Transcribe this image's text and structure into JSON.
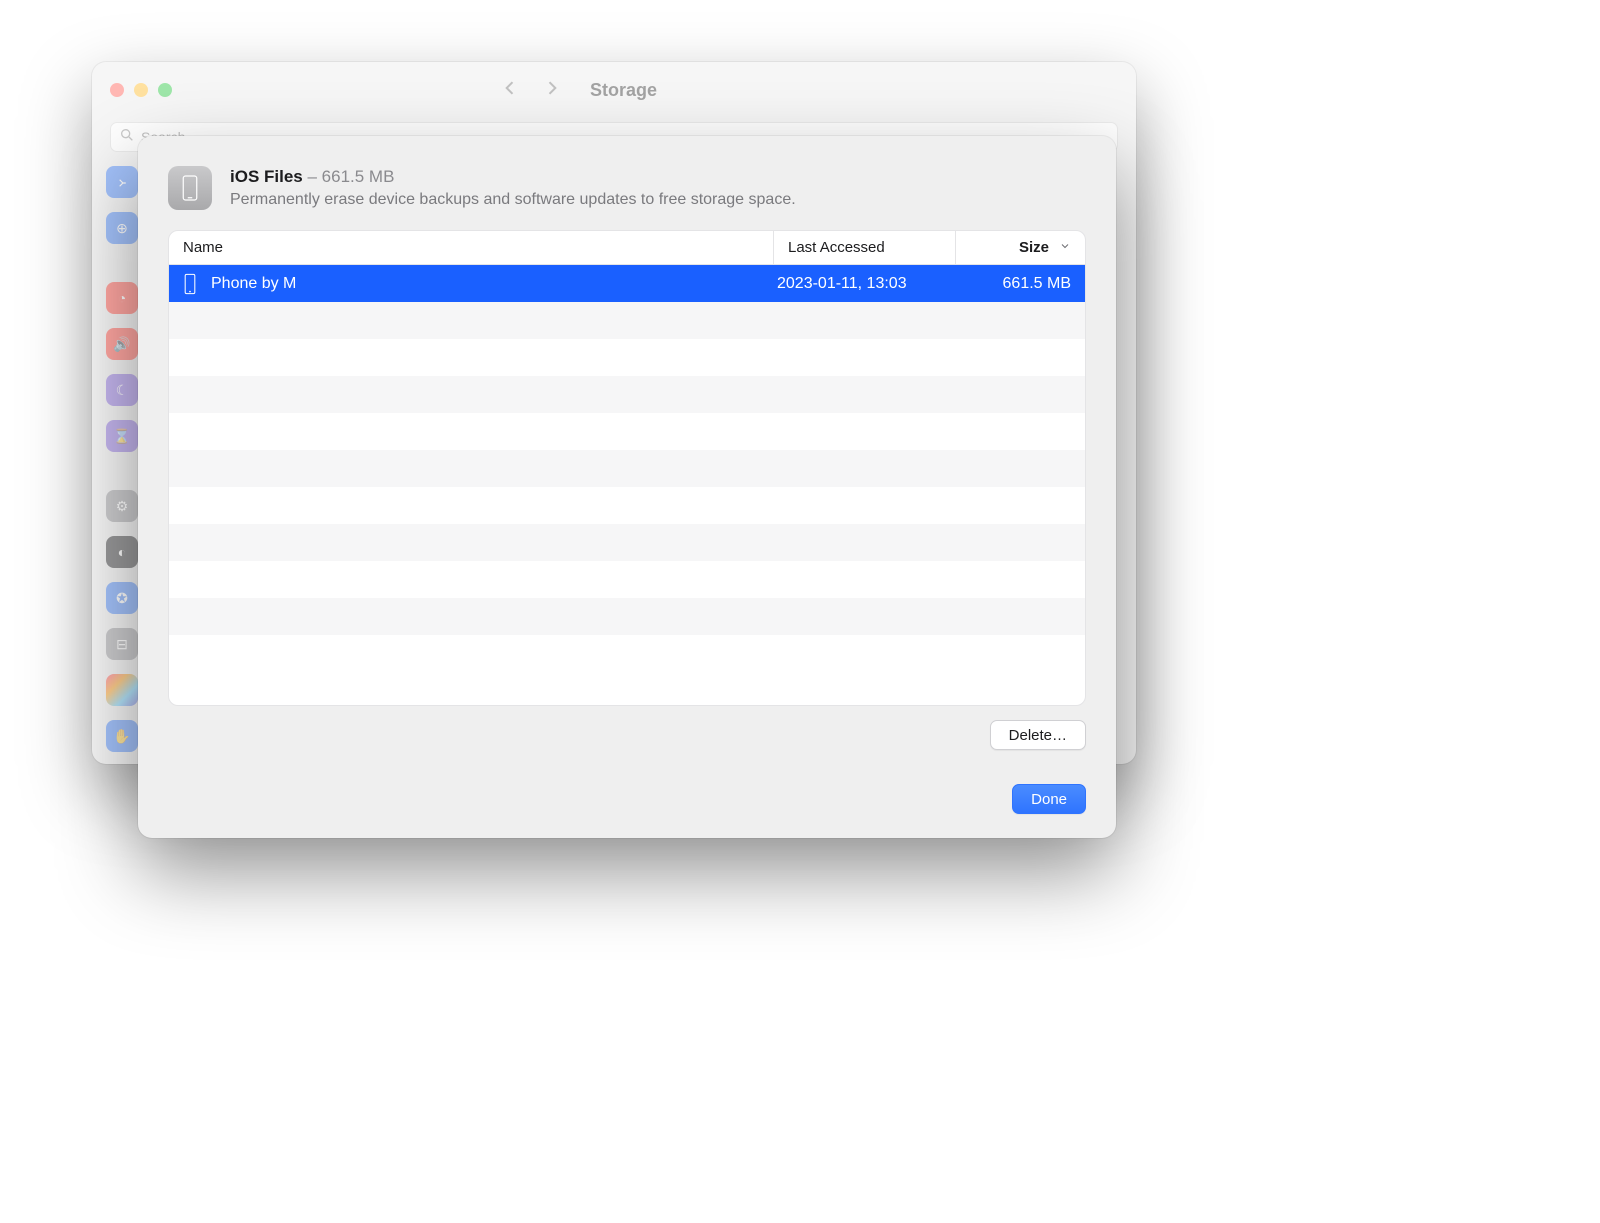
{
  "outer": {
    "title": "Storage",
    "search_placeholder": "Search"
  },
  "sheet": {
    "title": "iOS Files",
    "title_sep": " – ",
    "size_summary": "661.5 MB",
    "subtitle": "Permanently erase device backups and software updates to free storage space.",
    "columns": {
      "name": "Name",
      "last_accessed": "Last Accessed",
      "size": "Size"
    },
    "rows": [
      {
        "name": "Phone by M",
        "last_accessed": "2023-01-11, 13:03",
        "size": "661.5 MB",
        "selected": true
      }
    ],
    "buttons": {
      "delete": "Delete…",
      "done": "Done"
    }
  },
  "sidebar_icons": [
    "bluetooth-icon",
    "network-icon",
    "notifications-icon",
    "sound-icon",
    "focus-icon",
    "screentime-icon",
    "general-icon",
    "appearance-icon",
    "accessibility-icon",
    "control-center-icon",
    "siri-icon",
    "privacy-icon"
  ]
}
